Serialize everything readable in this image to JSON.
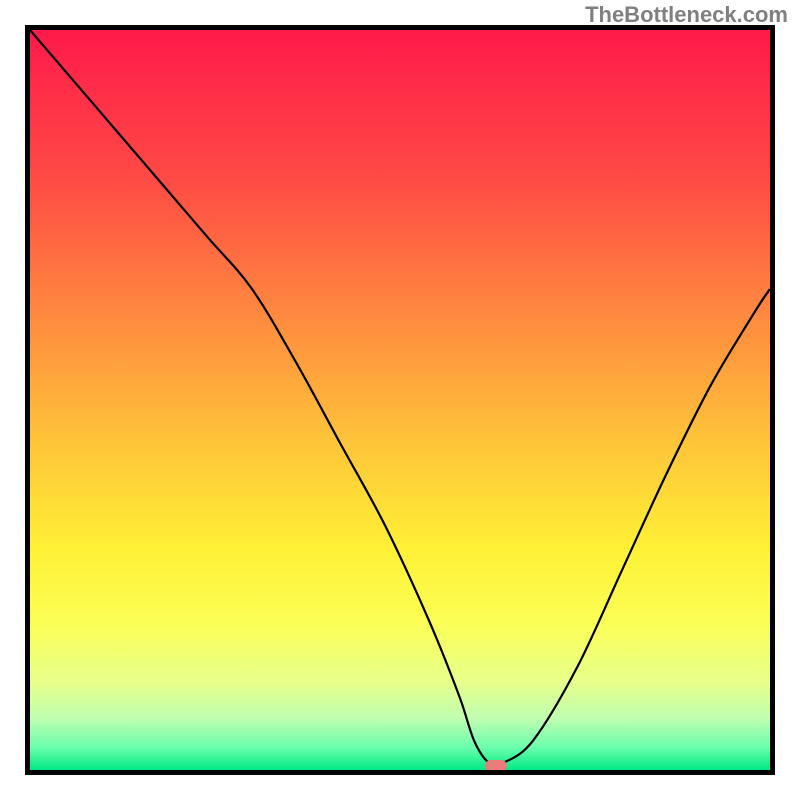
{
  "watermark": "TheBottleneck.com",
  "chart_data": {
    "type": "line",
    "title": "",
    "xlabel": "",
    "ylabel": "",
    "x_range": [
      0,
      100
    ],
    "y_range": [
      0,
      100
    ],
    "background_gradient": [
      {
        "pos": 0.0,
        "color": "#ff1a4a"
      },
      {
        "pos": 0.2,
        "color": "#ff4a45"
      },
      {
        "pos": 0.4,
        "color": "#ff8e3f"
      },
      {
        "pos": 0.55,
        "color": "#ffc23a"
      },
      {
        "pos": 0.7,
        "color": "#fff035"
      },
      {
        "pos": 0.8,
        "color": "#fbff55"
      },
      {
        "pos": 0.88,
        "color": "#e8ff8a"
      },
      {
        "pos": 0.93,
        "color": "#c0ffb0"
      },
      {
        "pos": 0.97,
        "color": "#6affad"
      },
      {
        "pos": 1.0,
        "color": "#00e884"
      }
    ],
    "series": [
      {
        "name": "bottleneck-curve",
        "color": "#000000",
        "x": [
          0,
          6,
          12,
          18,
          24,
          30,
          36,
          42,
          48,
          54,
          58,
          60,
          62,
          64,
          68,
          74,
          80,
          86,
          92,
          98,
          100
        ],
        "y": [
          100,
          93,
          86,
          79,
          72,
          65,
          55,
          44,
          33,
          20,
          10,
          4,
          1,
          1,
          4,
          14,
          27,
          40,
          52,
          62,
          65
        ]
      }
    ],
    "marker": {
      "x": 63,
      "y": 0,
      "color": "#ea7c79"
    },
    "annotations": []
  }
}
